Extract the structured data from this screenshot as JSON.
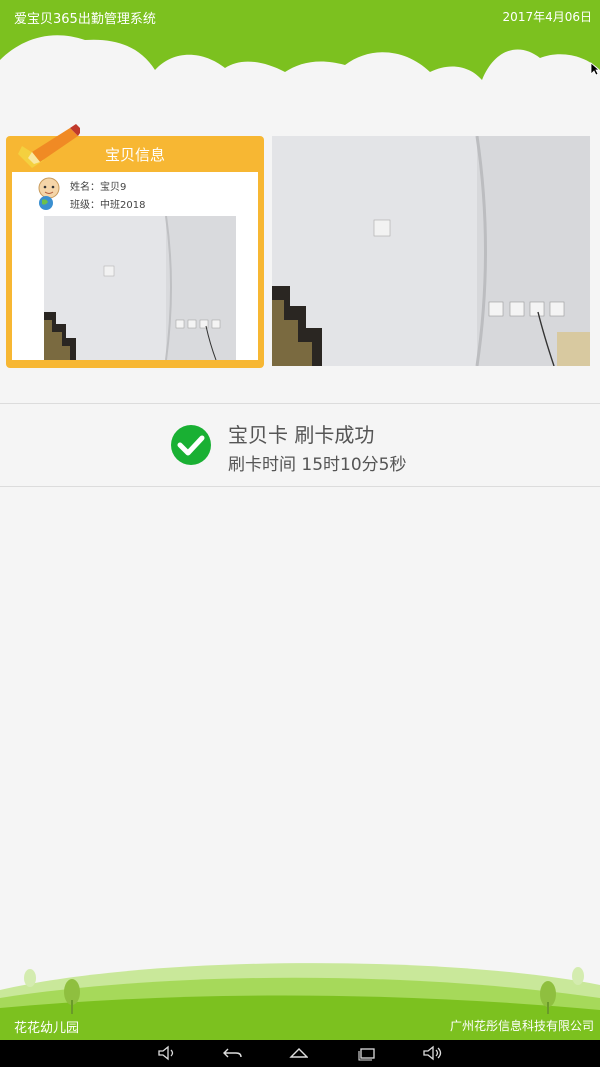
{
  "header": {
    "app_title": "爱宝贝365出勤管理系统",
    "date": "2017年4月06日"
  },
  "info_card": {
    "title": "宝贝信息",
    "name_line": "姓名：宝贝9",
    "class_line": "班级：中班2018"
  },
  "status": {
    "title": "宝贝卡 刷卡成功",
    "time": "刷卡时间 15时10分5秒"
  },
  "footer": {
    "school": "花花幼儿园",
    "company": "广州花彤信息科技有限公司"
  },
  "icons": {
    "check": "check-circle-icon",
    "pencil": "pencil-icon",
    "avatar": "baby-avatar-icon",
    "nav": [
      "volume-down-icon",
      "back-icon",
      "home-icon",
      "recents-icon",
      "volume-up-icon"
    ]
  },
  "colors": {
    "brand_green": "#7cc11f",
    "card_orange": "#f7b733",
    "success_green": "#19b033"
  }
}
